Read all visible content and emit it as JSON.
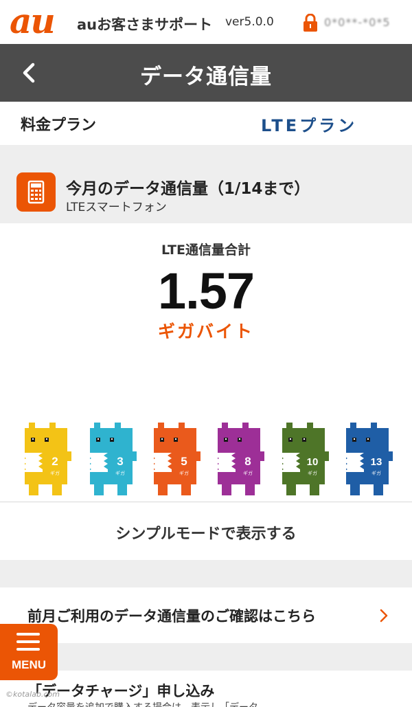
{
  "appbar": {
    "logo": "au",
    "app_name": "auお客さまサポート",
    "version": "ver5.0.0",
    "user_id": "0*0**-*0*5",
    "icons": {
      "lock": "lock-icon"
    }
  },
  "titlebar": {
    "title": "データ通信量",
    "back_icon": "chevron-left-icon"
  },
  "plan": {
    "label": "料金プラン",
    "value": "LTEプラン"
  },
  "usage": {
    "title": "今月のデータ通信量（1/14まで）",
    "subtitle": "LTEスマートフォン",
    "icon": "calculator-icon",
    "total_label": "LTE通信量合計",
    "total_value": "1.57",
    "total_unit": "ギガバイト"
  },
  "mascots": [
    {
      "number": "2",
      "color": "#f3c316"
    },
    {
      "number": "3",
      "color": "#2fb3cf"
    },
    {
      "number": "5",
      "color": "#ea5a1c"
    },
    {
      "number": "8",
      "color": "#9d2f97"
    },
    {
      "number": "10",
      "color": "#4e7528"
    },
    {
      "number": "13",
      "color": "#1f5ea6"
    }
  ],
  "mascot_unit": "ギガ",
  "simple_mode": {
    "label": "シンプルモードで表示する"
  },
  "links": {
    "prev_month": "前月ご利用のデータ通信量のご確認はこちら",
    "charge": "「データチャージ」申し込み",
    "charge_sub": "データ容量を追加で購入する場合は、表示し「データ"
  },
  "menu": {
    "label": "MENU",
    "icon": "hamburger-icon"
  },
  "watermark": "©kotalab.com",
  "colors": {
    "accent": "#eb5505",
    "titlebar": "#4c4c4c",
    "plan_value": "#1d4f8b",
    "gap": "#eeeeee"
  }
}
